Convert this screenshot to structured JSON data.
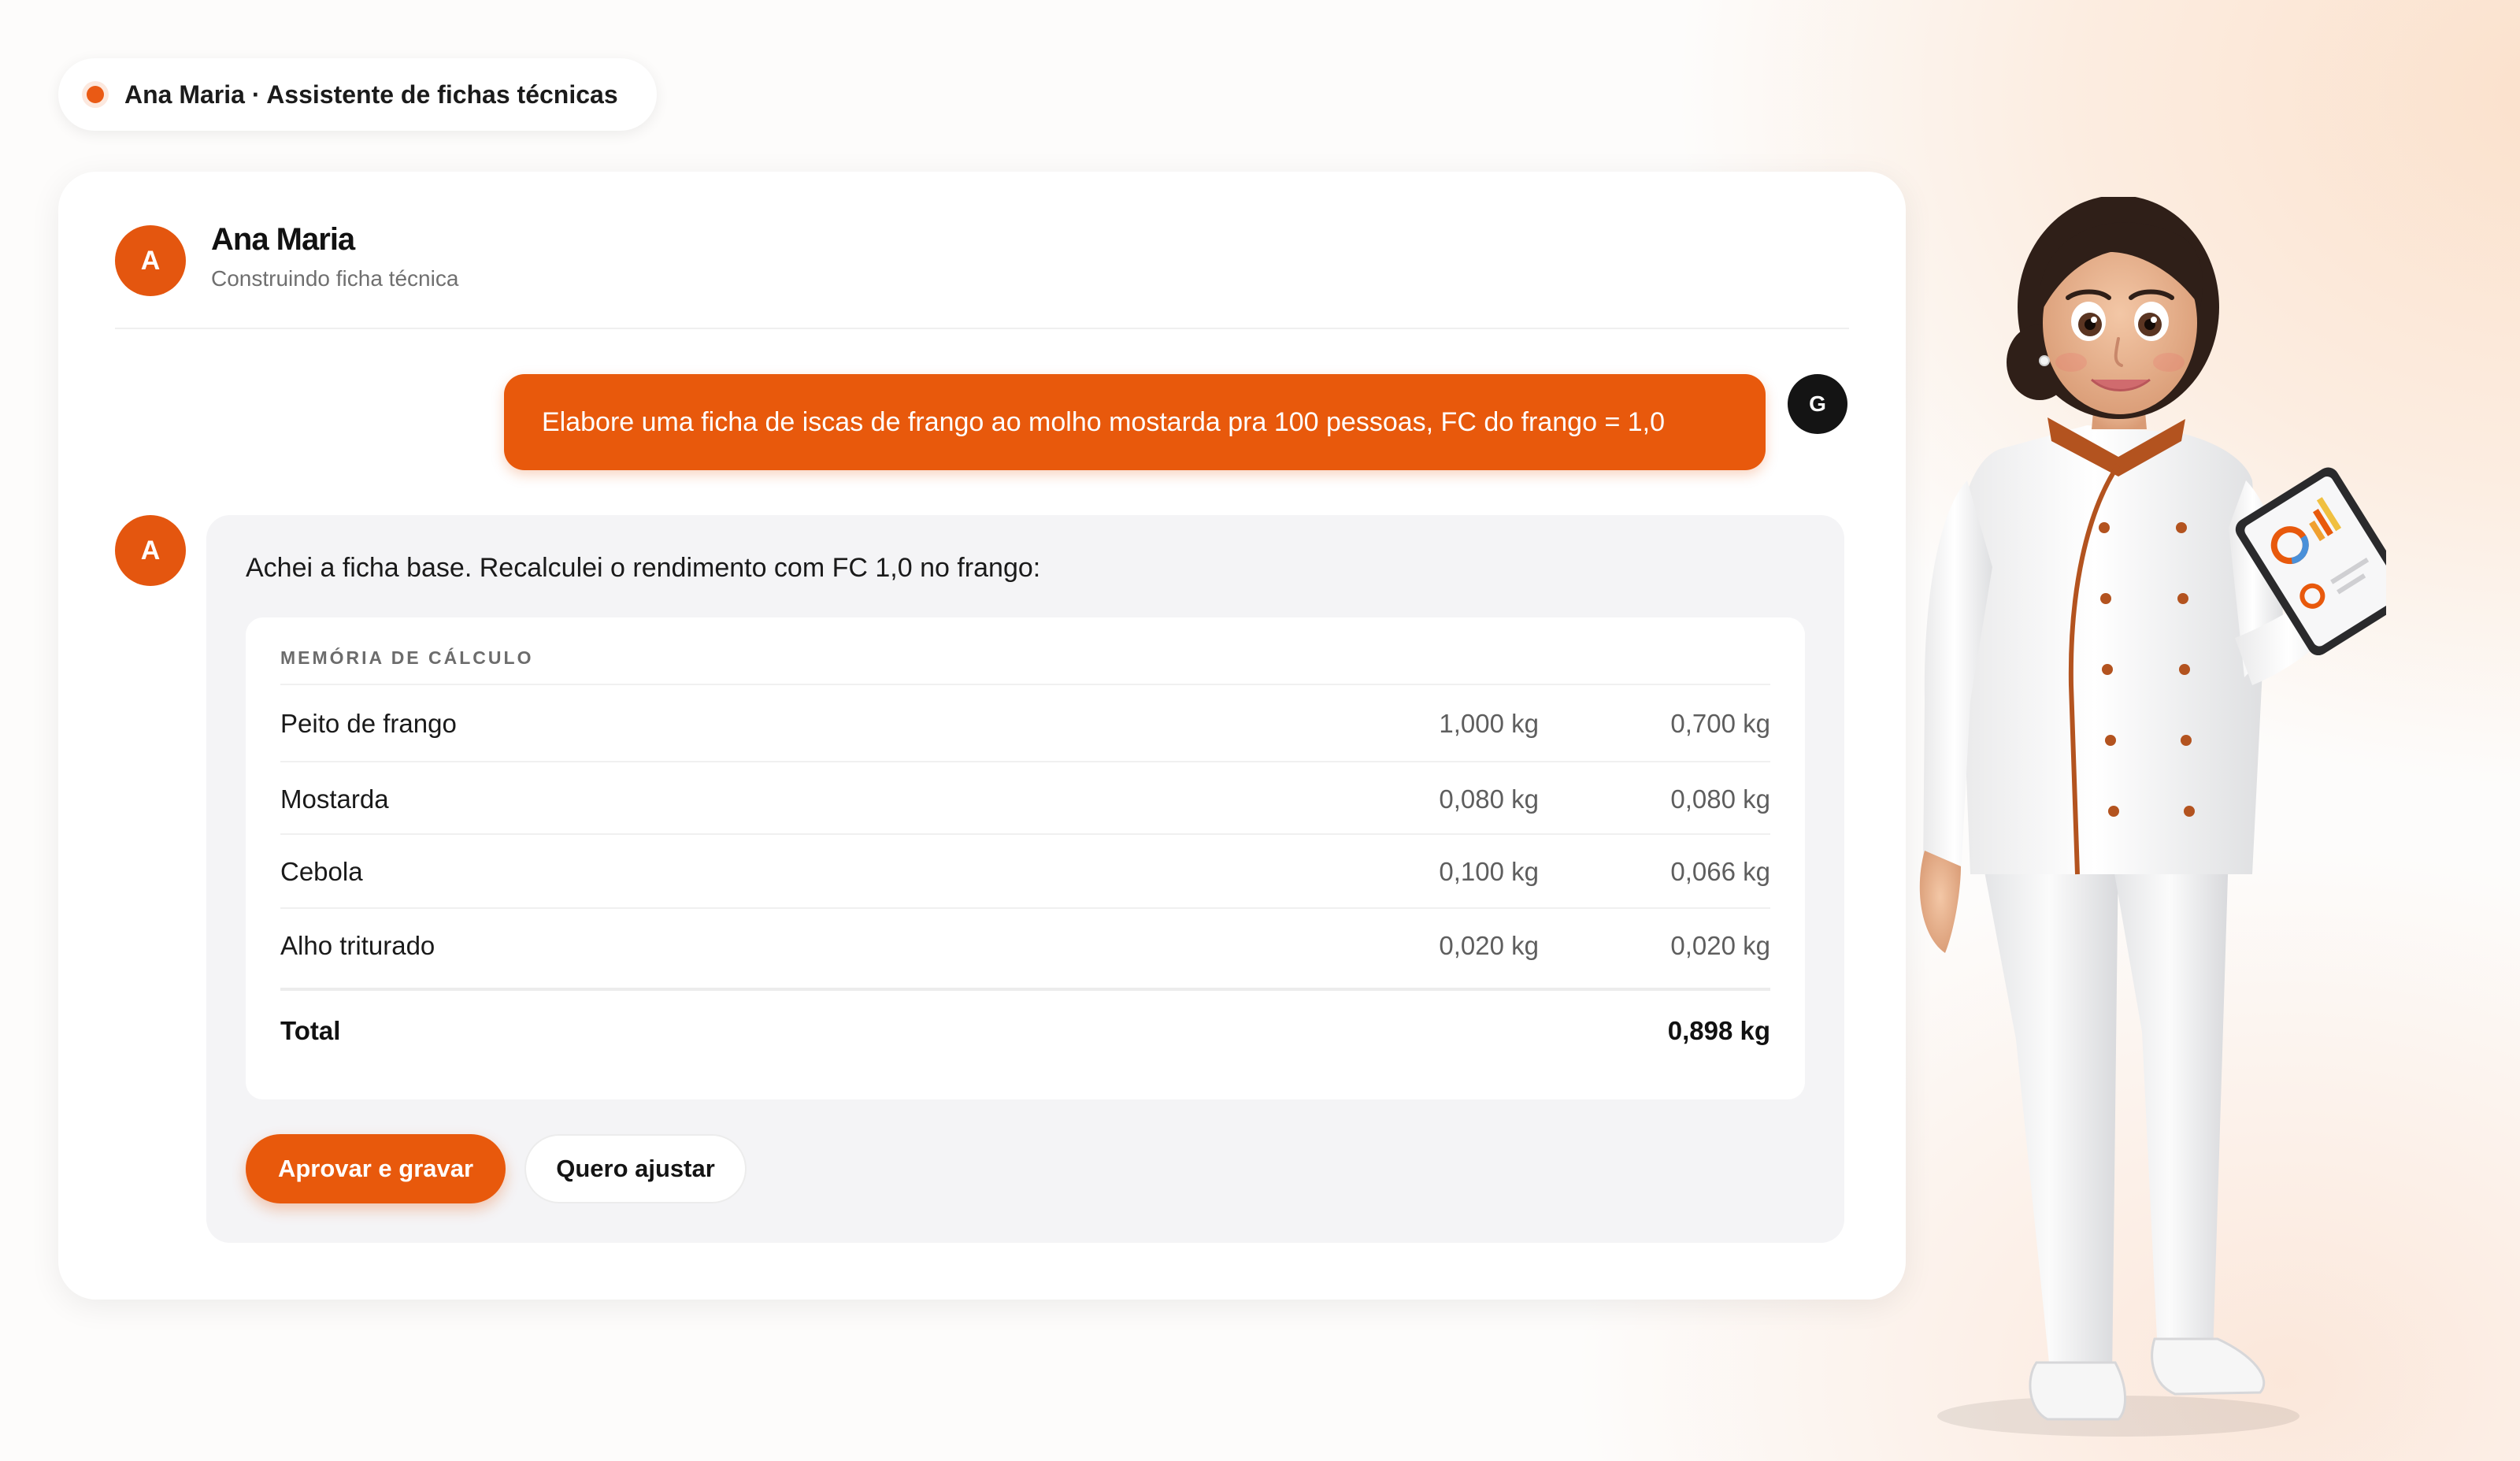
{
  "top_pill": {
    "label": "Ana Maria · Assistente de fichas técnicas"
  },
  "header": {
    "avatar_letter": "A",
    "name": "Ana Maria",
    "status": "Construindo ficha técnica"
  },
  "user_message": {
    "avatar_letter": "G",
    "text": "Elabore uma ficha de iscas de frango ao molho mostarda pra 100 pessoas, FC do frango = 1,0"
  },
  "assistant_message": {
    "avatar_letter": "A",
    "text": "Achei a ficha base. Recalculei o rendimento com FC 1,0 no frango:",
    "calc": {
      "title": "MEMÓRIA DE CÁLCULO",
      "rows": [
        {
          "name": "Peito de frango",
          "v1": "1,000 kg",
          "v2": "0,700 kg"
        },
        {
          "name": "Mostarda",
          "v1": "0,080 kg",
          "v2": "0,080 kg"
        },
        {
          "name": "Cebola",
          "v1": "0,100 kg",
          "v2": "0,066 kg"
        },
        {
          "name": "Alho triturado",
          "v1": "0,020 kg",
          "v2": "0,020 kg"
        }
      ],
      "total": {
        "name": "Total",
        "value": "0,898 kg"
      }
    },
    "buttons": {
      "approve": "Aprovar e gravar",
      "adjust": "Quero ajustar"
    }
  },
  "colors": {
    "accent": "#e8590c",
    "dark": "#141414",
    "bubble_bg": "#f4f4f6"
  }
}
